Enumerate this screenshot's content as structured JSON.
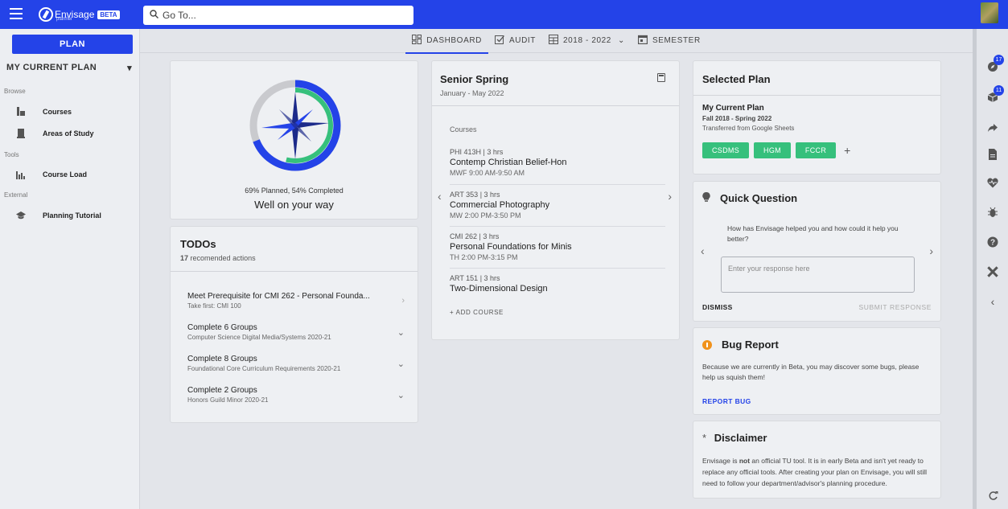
{
  "header": {
    "logo_text": "Envisage",
    "logo_sub": "planner",
    "beta_label": "BETA",
    "search_placeholder": "Go To..."
  },
  "sidebar": {
    "plan_button": "PLAN",
    "plan_select": "MY CURRENT PLAN",
    "sections": [
      {
        "label": "Browse",
        "items": [
          {
            "label": "Courses",
            "icon": "courses-icon"
          },
          {
            "label": "Areas of Study",
            "icon": "book-icon"
          }
        ]
      },
      {
        "label": "Tools",
        "items": [
          {
            "label": "Course Load",
            "icon": "chart-icon"
          }
        ]
      },
      {
        "label": "External",
        "items": [
          {
            "label": "Planning Tutorial",
            "icon": "school-icon"
          }
        ]
      }
    ]
  },
  "view_tabs": [
    {
      "label": "DASHBOARD",
      "icon": "dashboard-icon",
      "active": true
    },
    {
      "label": "AUDIT",
      "icon": "checkbox-icon",
      "active": false
    },
    {
      "label": "2018 - 2022",
      "icon": "grid-icon",
      "active": false
    },
    {
      "label": "SEMESTER",
      "icon": "calendar-icon",
      "active": false
    }
  ],
  "progress": {
    "summary": "69% Planned, 54% Completed",
    "status": "Well on your way",
    "planned_fraction": 0.69,
    "completed_fraction": 0.54
  },
  "todos": {
    "title": "TODOs",
    "count": "17",
    "count_suffix": "recomended actions",
    "items": [
      {
        "title": "Meet Prerequisite for CMI 262 - Personal Founda...",
        "sub": "Take first: CMI 100"
      },
      {
        "title": "Complete 6 Groups",
        "sub": "Computer Science Digital Media/Systems 2020-21"
      },
      {
        "title": "Complete 8 Groups",
        "sub": "Foundational Core Curriculum Requirements 2020-21"
      },
      {
        "title": "Complete 2 Groups",
        "sub": "Honors Guild Minor 2020-21"
      }
    ]
  },
  "semester": {
    "title": "Senior Spring",
    "dates": "January - May 2022",
    "courses_label": "Courses",
    "courses": [
      {
        "meta": "PHI 413H | 3 hrs",
        "name": "Contemp Christian Belief-Hon",
        "time": "MWF 9:00 AM-9:50 AM"
      },
      {
        "meta": "ART 353 | 3 hrs",
        "name": "Commercial Photography",
        "time": "MW 2:00 PM-3:50 PM"
      },
      {
        "meta": "CMI 262 | 3 hrs",
        "name": "Personal Foundations for Minis",
        "time": "TH 2:00 PM-3:15 PM"
      },
      {
        "meta": "ART 151 | 3 hrs",
        "name": "Two-Dimensional Design",
        "time": ""
      }
    ],
    "add_course": "+ ADD COURSE"
  },
  "selected_plan": {
    "title": "Selected Plan",
    "name": "My Current Plan",
    "range": "Fall 2018 - Spring 2022",
    "note": "Transferred from Google Sheets",
    "chips": [
      "CSDMS",
      "HGM",
      "FCCR"
    ],
    "chip_color": "#36c07c"
  },
  "quick_question": {
    "title": "Quick Question",
    "question": "How has Envisage helped you and how could it help you better?",
    "placeholder": "Enter your response here",
    "dismiss": "DISMISS",
    "submit": "SUBMIT RESPONSE"
  },
  "bug_report": {
    "title": "Bug Report",
    "text": "Because we are currently in Beta, you may discover some bugs, please help us squish them!",
    "link": "REPORT BUG"
  },
  "disclaimer": {
    "title": "Disclaimer",
    "text_before": "Envisage is ",
    "text_bold": "not",
    "text_after": " an official TU tool. It is in early Beta and isn't yet ready to replace any official tools. After creating your plan on Envisage, you will still need to follow your department/advisor's planning procedure."
  },
  "rail": {
    "badge_1": "17",
    "badge_2": "11"
  },
  "colors": {
    "brand": "#2443e8",
    "completed": "#36c07c",
    "warning": "#f0921c"
  }
}
